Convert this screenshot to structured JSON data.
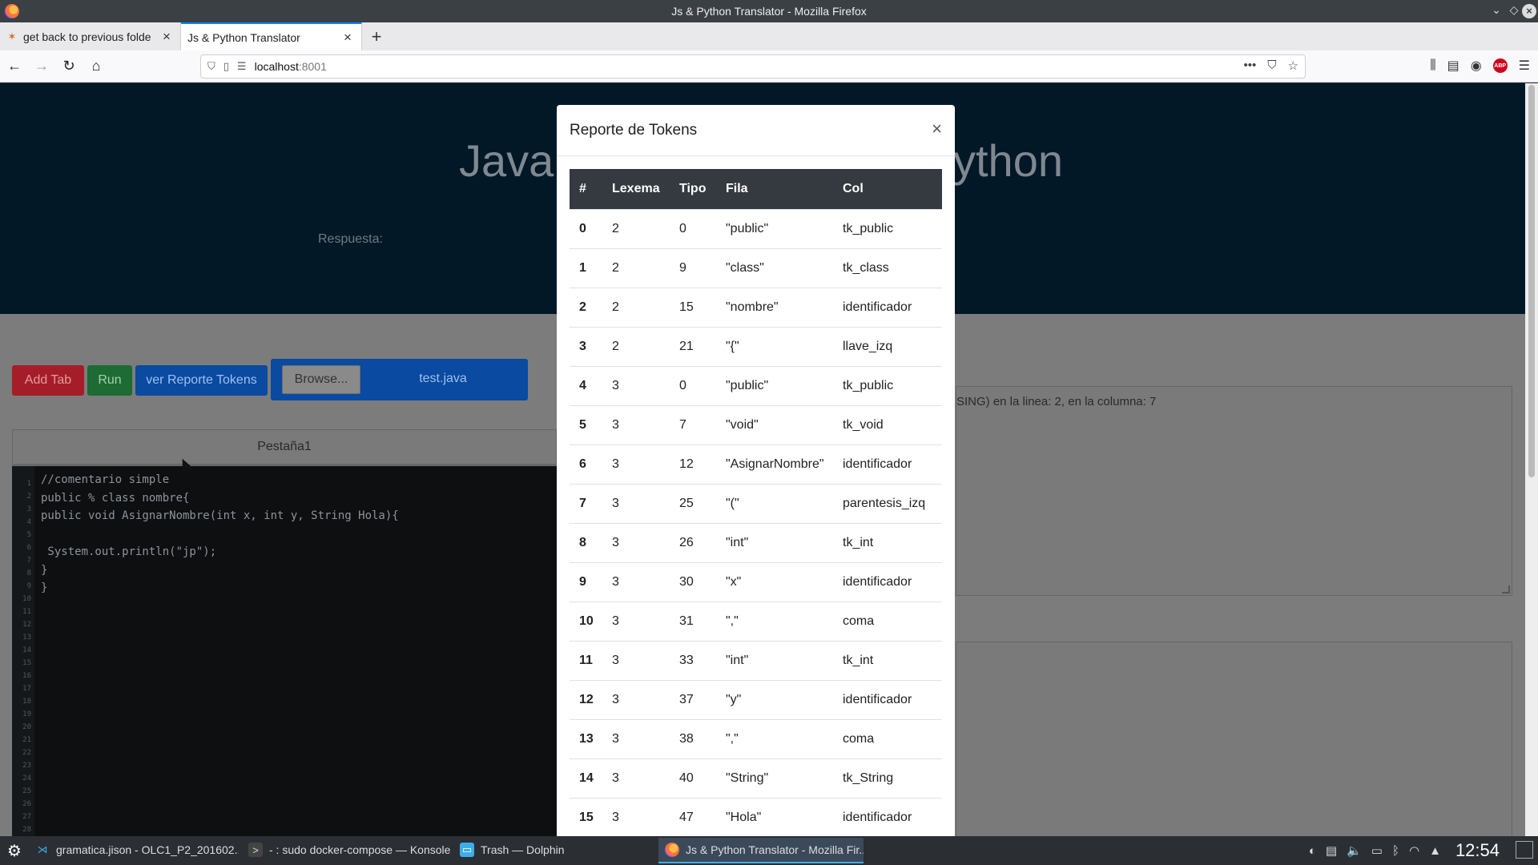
{
  "window": {
    "title": "Js & Python Translator - Mozilla Firefox"
  },
  "browser": {
    "tabs": [
      {
        "label": "get back to previous folde",
        "active": false
      },
      {
        "label": "Js & Python Translator",
        "active": true
      }
    ],
    "url_host": "localhost",
    "url_port": ":8001"
  },
  "page": {
    "hero_title": "Java                                        Python",
    "hero_title_left": "Java",
    "hero_title_right": "ython",
    "response_label": "Respuesta:",
    "buttons": {
      "add_tab": "Add Tab",
      "run": "Run",
      "report": "ver Reporte Tokens",
      "browse": "Browse..."
    },
    "file_name": "test.java",
    "editor_tab": "Pestaña1",
    "code_lines": [
      "//comentario simple",
      "public % class nombre{",
      "public void AsignarNombre(int x, int y, String Hola){",
      "",
      " System.out.println(\"jp\");",
      "}",
      "}"
    ],
    "line_numbers": "1\n2\n3\n4\n5\n6\n7\n8\n9\n10\n11\n12\n13\n14\n15\n16\n17\n18\n19\n20\n21\n22\n23\n24\n25\n26\n27\n28",
    "console_text": "SING) en la linea: 2, en la columna: 7"
  },
  "modal": {
    "title": "Reporte de Tokens",
    "close": "×",
    "headers": [
      "#",
      "Lexema",
      "Tipo",
      "Fila",
      "Col"
    ],
    "rows": [
      [
        "0",
        "2",
        "0",
        "\"public\"",
        "tk_public"
      ],
      [
        "1",
        "2",
        "9",
        "\"class\"",
        "tk_class"
      ],
      [
        "2",
        "2",
        "15",
        "\"nombre\"",
        "identificador"
      ],
      [
        "3",
        "2",
        "21",
        "\"{\"",
        "llave_izq"
      ],
      [
        "4",
        "3",
        "0",
        "\"public\"",
        "tk_public"
      ],
      [
        "5",
        "3",
        "7",
        "\"void\"",
        "tk_void"
      ],
      [
        "6",
        "3",
        "12",
        "\"AsignarNombre\"",
        "identificador"
      ],
      [
        "7",
        "3",
        "25",
        "\"(\"",
        "parentesis_izq"
      ],
      [
        "8",
        "3",
        "26",
        "\"int\"",
        "tk_int"
      ],
      [
        "9",
        "3",
        "30",
        "\"x\"",
        "identificador"
      ],
      [
        "10",
        "3",
        "31",
        "\",\"",
        "coma"
      ],
      [
        "11",
        "3",
        "33",
        "\"int\"",
        "tk_int"
      ],
      [
        "12",
        "3",
        "37",
        "\"y\"",
        "identificador"
      ],
      [
        "13",
        "3",
        "38",
        "\",\"",
        "coma"
      ],
      [
        "14",
        "3",
        "40",
        "\"String\"",
        "tk_String"
      ],
      [
        "15",
        "3",
        "47",
        "\"Hola\"",
        "identificador"
      ]
    ]
  },
  "taskbar": {
    "tasks": [
      {
        "label": "gramatica.jison - OLC1_P2_201602...",
        "icon": "vscode-icon",
        "active": false
      },
      {
        "label": "- : sudo docker-compose — Konsole",
        "icon": "terminal-icon",
        "active": false
      },
      {
        "label": "Trash — Dolphin",
        "icon": "folder-icon",
        "active": false
      },
      {
        "label": "Js & Python Translator - Mozilla Fir...",
        "icon": "firefox-icon",
        "active": true
      }
    ],
    "clock": "12:54"
  }
}
